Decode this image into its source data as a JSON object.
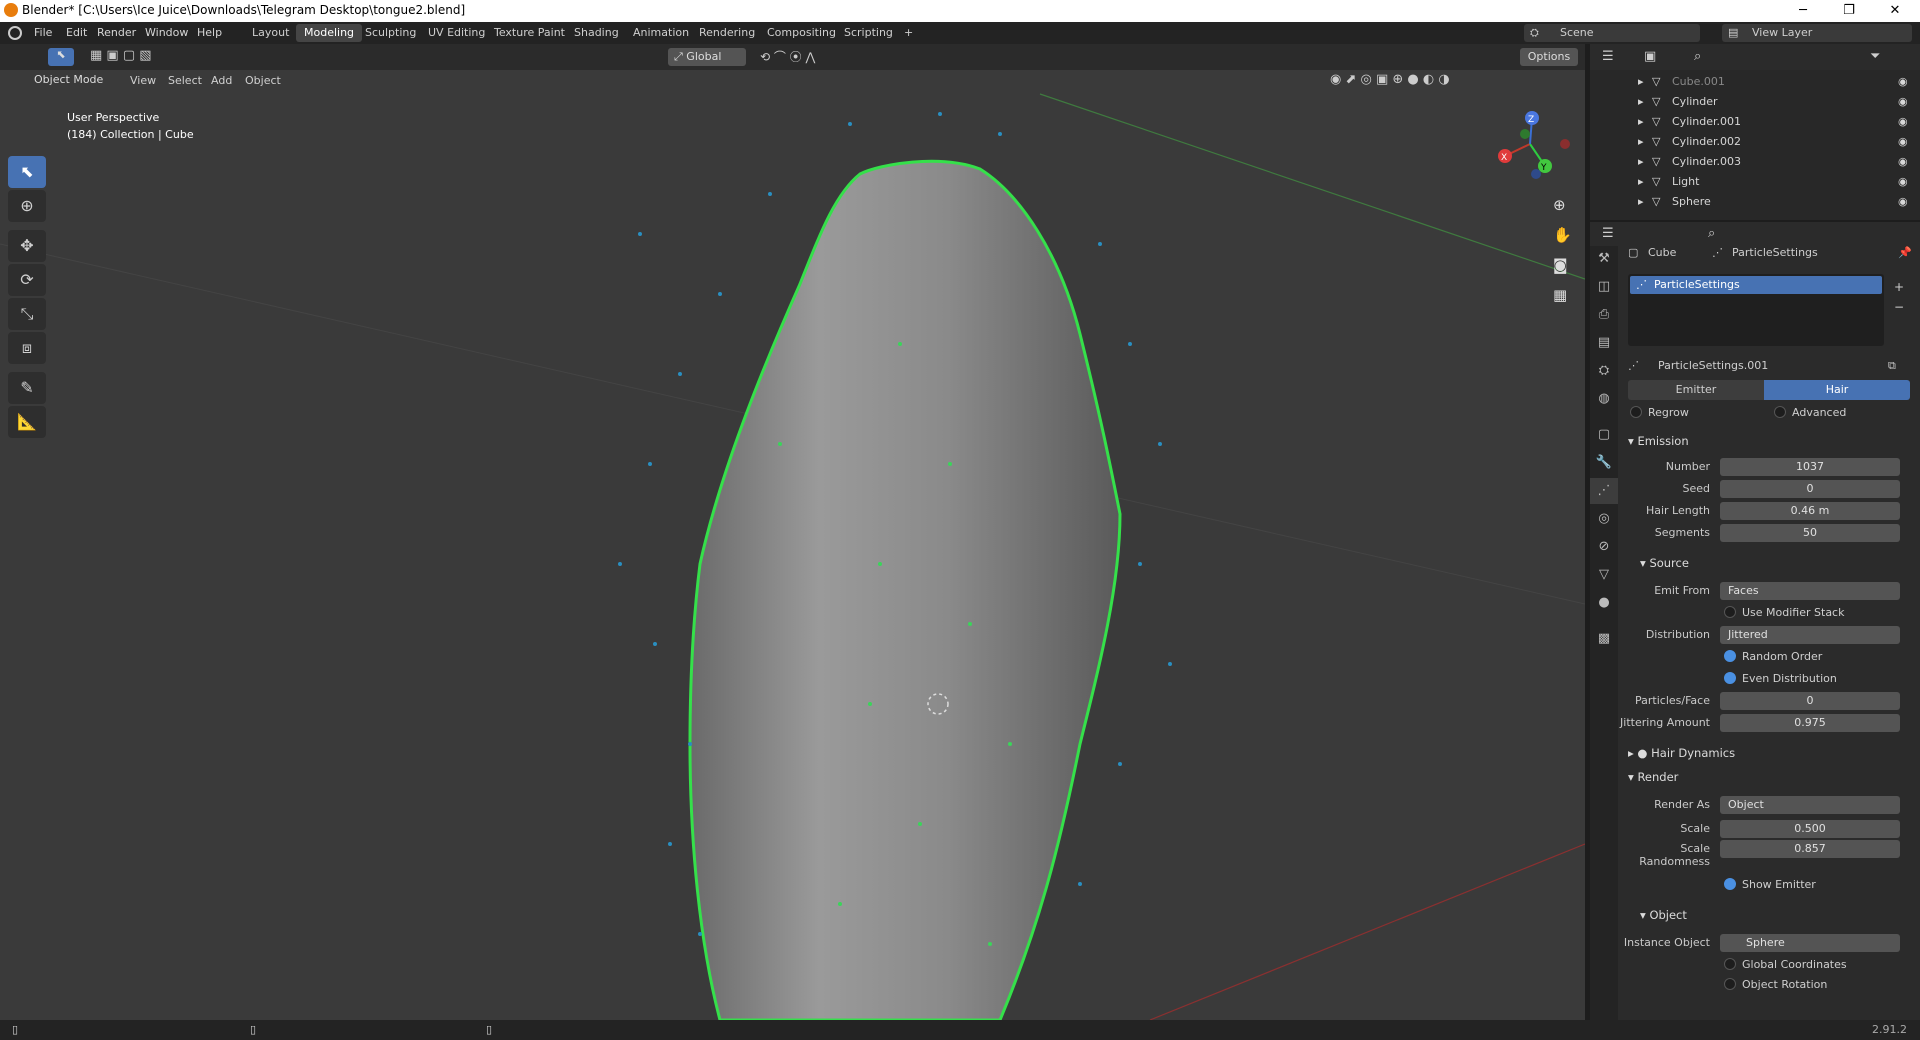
{
  "titlebar": {
    "title": "Blender* [C:\\Users\\Ice Juice\\Downloads\\Telegram Desktop\\tongue2.blend]",
    "minimize": "─",
    "maximize": "❐",
    "close": "✕"
  },
  "menu": [
    "File",
    "Edit",
    "Render",
    "Window",
    "Help"
  ],
  "workspaces": [
    "Layout",
    "Modeling",
    "Sculpting",
    "UV Editing",
    "Texture Paint",
    "Shading",
    "Animation",
    "Rendering",
    "Compositing",
    "Scripting",
    "+"
  ],
  "active_workspace": "Modeling",
  "scene": {
    "label": "Scene",
    "view_layer": "View Layer"
  },
  "viewport": {
    "transform_orientation": "Global",
    "options": "Options",
    "mode": "Object Mode",
    "menus": [
      "View",
      "Select",
      "Add",
      "Object"
    ],
    "overlay_title": "User Perspective",
    "overlay_subtitle": "(184) Collection | Cube",
    "gizmo_axes": {
      "x": "X",
      "y": "Y",
      "z": "Z"
    }
  },
  "outliner": {
    "items": [
      {
        "name": "Cube.001",
        "dim": true
      },
      {
        "name": "Cylinder",
        "dim": false
      },
      {
        "name": "Cylinder.001",
        "dim": false
      },
      {
        "name": "Cylinder.002",
        "dim": false
      },
      {
        "name": "Cylinder.003",
        "dim": false
      },
      {
        "name": "Light",
        "dim": false
      },
      {
        "name": "Sphere",
        "dim": false
      }
    ]
  },
  "properties": {
    "breadcrumb_object": "Cube",
    "breadcrumb_settings": "ParticleSettings",
    "list_item": "ParticleSettings",
    "datablock": "ParticleSettings.001",
    "type_emitter": "Emitter",
    "type_hair": "Hair",
    "regrow": "Regrow",
    "advanced": "Advanced",
    "emission": {
      "header": "Emission",
      "number_label": "Number",
      "number": "1037",
      "seed_label": "Seed",
      "seed": "0",
      "hair_length_label": "Hair Length",
      "hair_length": "0.46 m",
      "segments_label": "Segments",
      "segments": "50"
    },
    "source": {
      "header": "Source",
      "emit_from_label": "Emit From",
      "emit_from": "Faces",
      "use_modifier_stack": "Use Modifier Stack",
      "distribution_label": "Distribution",
      "distribution": "Jittered",
      "random_order": "Random Order",
      "even_distribution": "Even Distribution",
      "particles_face_label": "Particles/Face",
      "particles_face": "0",
      "jittering_label": "Jittering Amount",
      "jittering": "0.975"
    },
    "hair_dynamics": "Hair Dynamics",
    "render": {
      "header": "Render",
      "render_as_label": "Render As",
      "render_as": "Object",
      "scale_label": "Scale",
      "scale": "0.500",
      "scale_random_label": "Scale Randomness",
      "scale_random": "0.857",
      "show_emitter": "Show Emitter"
    },
    "object": {
      "header": "Object",
      "instance_label": "Instance Object",
      "instance": "Sphere",
      "global_coords": "Global Coordinates",
      "object_rotation": "Object Rotation"
    }
  },
  "status": {
    "version": "2.91.2"
  }
}
